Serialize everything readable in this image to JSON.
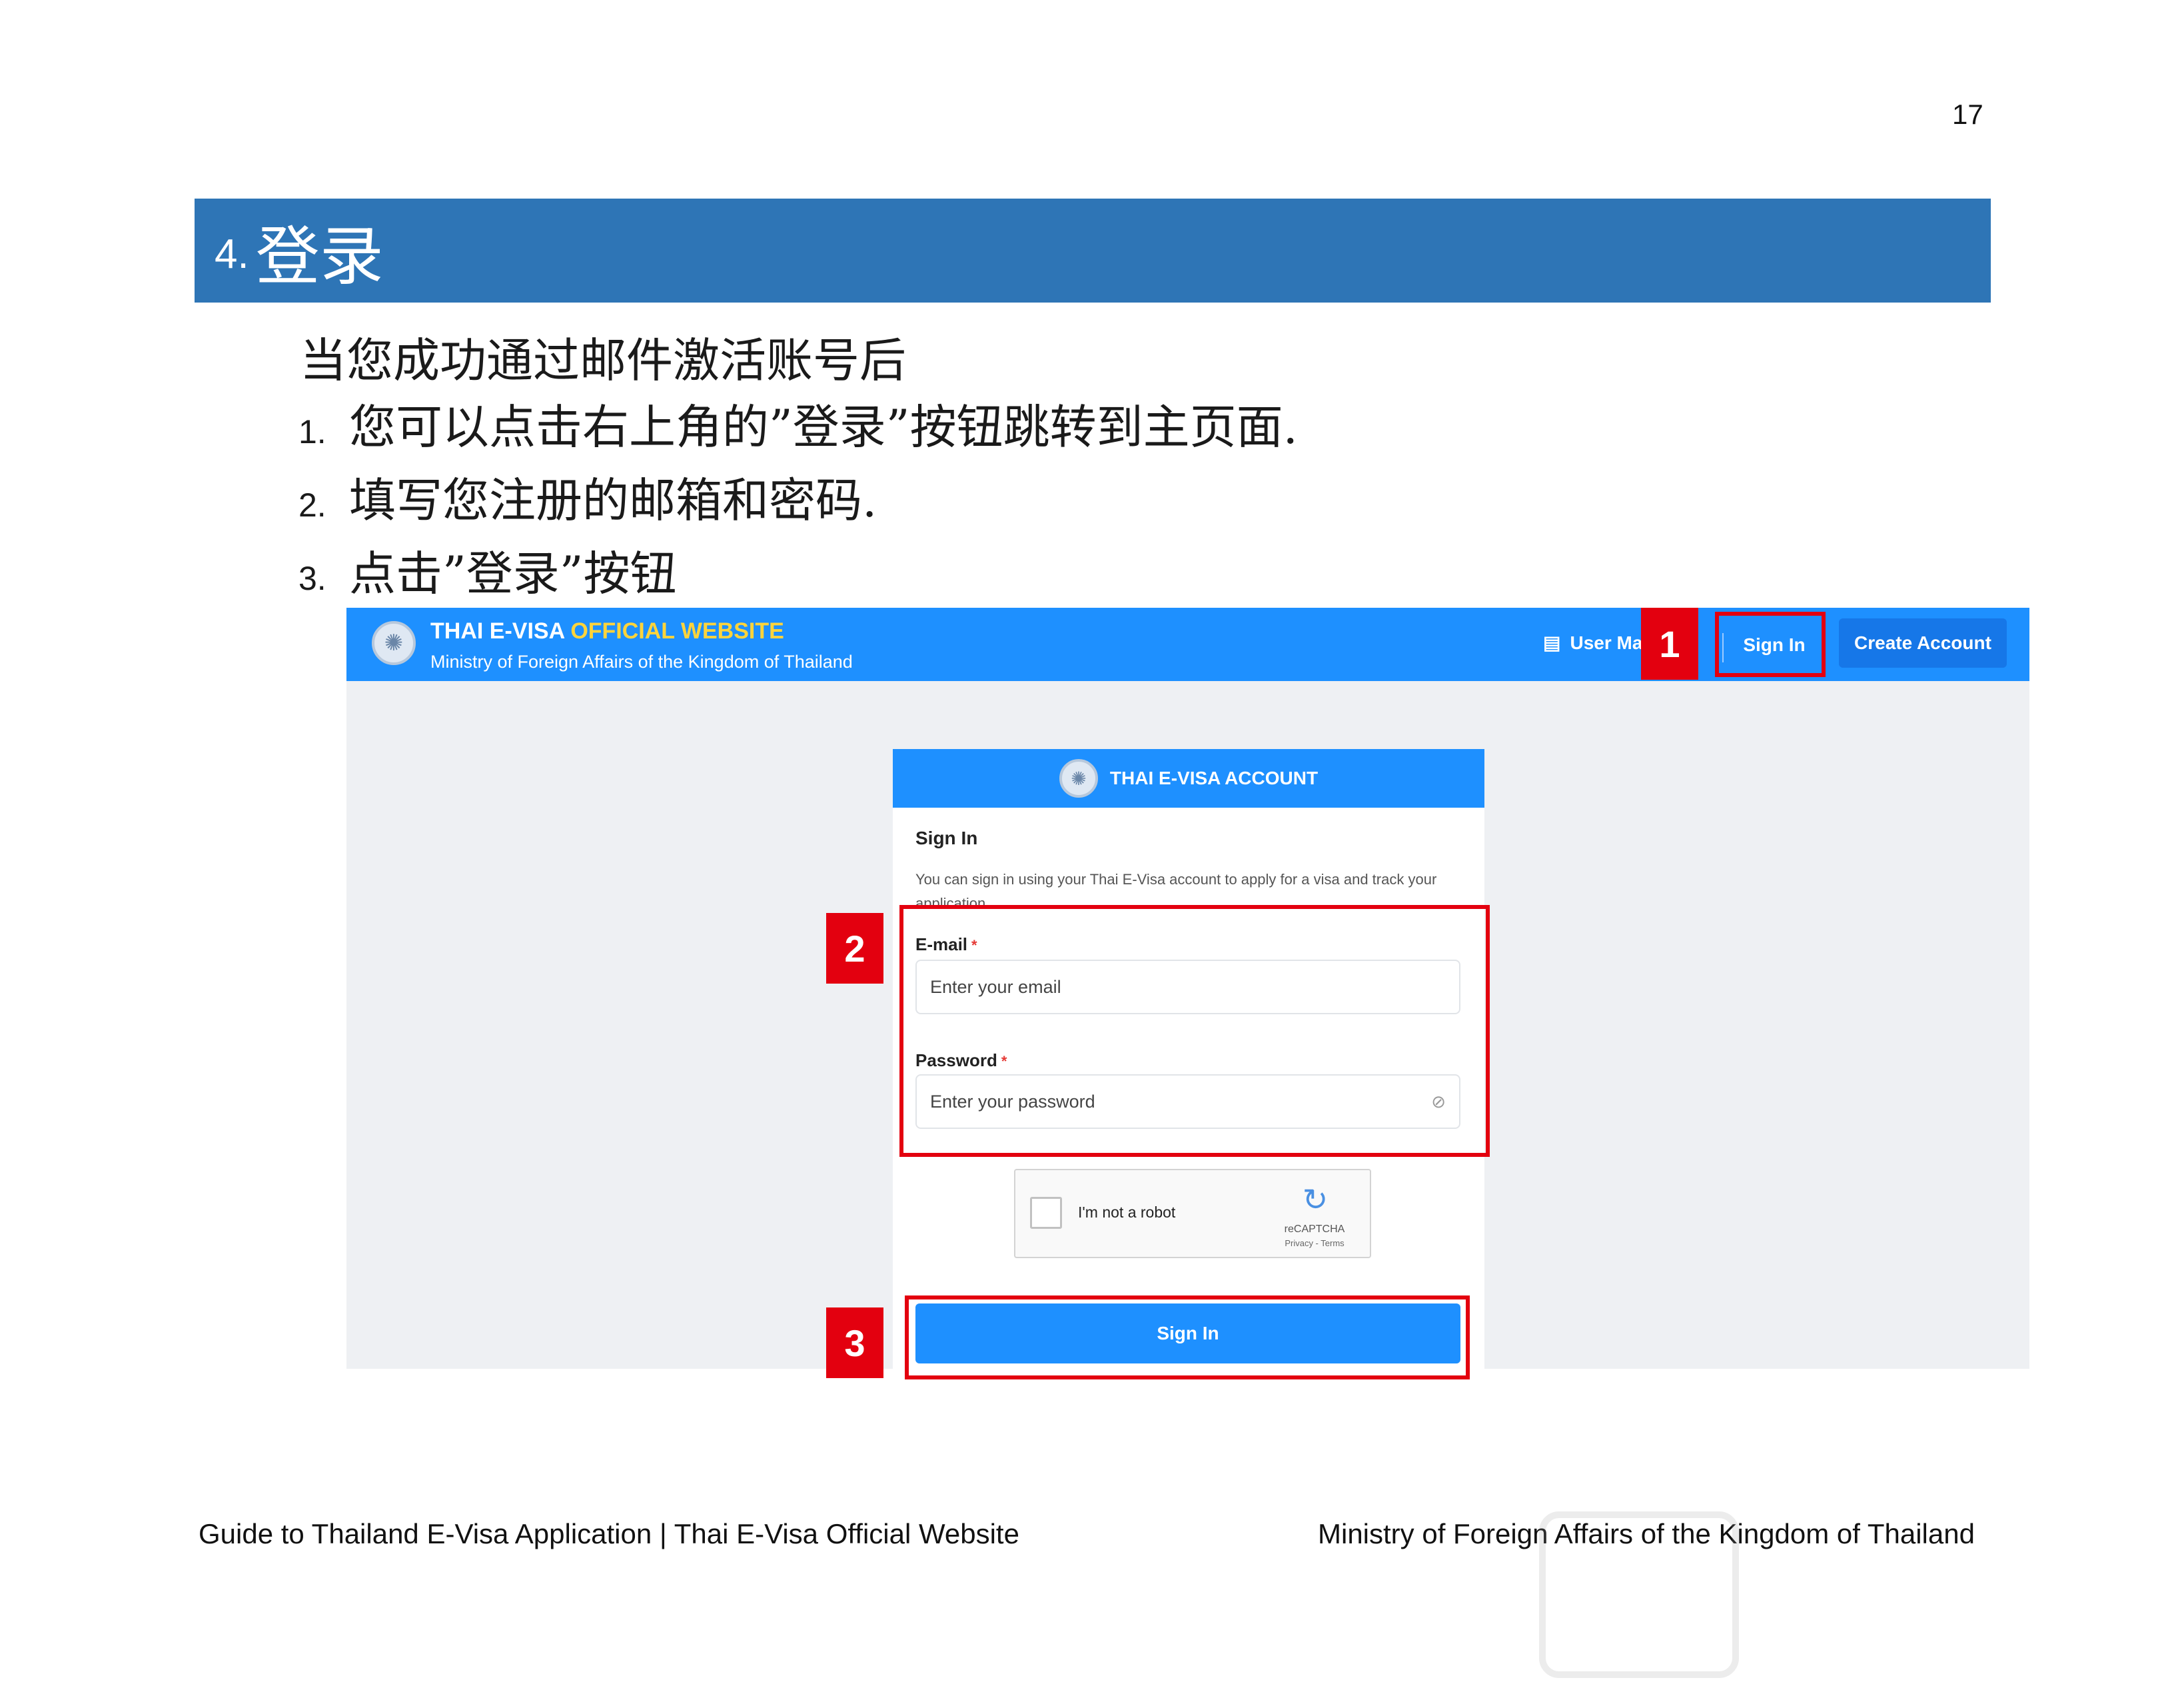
{
  "page_number": "17",
  "section": {
    "number": "4.",
    "title": "登录"
  },
  "intro": "当您成功通过邮件激活账号后",
  "steps": [
    {
      "n": "1.",
      "text": "您可以点击右上角的”登录”按钮跳转到主页面."
    },
    {
      "n": "2.",
      "text": "填写您注册的邮箱和密码."
    },
    {
      "n": "3.",
      "text": "点击”登录”按钮"
    }
  ],
  "screenshot": {
    "header": {
      "title_main": "THAI E-VISA ",
      "title_accent": "OFFICIAL WEBSITE",
      "subtitle": "Ministry of Foreign Affairs of the Kingdom of Thailand",
      "user_manual": "User Ma",
      "sign_in": "Sign In",
      "create_account": "Create Account"
    },
    "card": {
      "title": "THAI E-VISA ACCOUNT",
      "heading": "Sign In",
      "description": "You can sign in using your Thai E-Visa account to apply for a visa and track your application.",
      "email_label": "E-mail",
      "email_placeholder": "Enter your email",
      "password_label": "Password",
      "password_placeholder": "Enter your password",
      "required_mark": "*",
      "captcha_text": "I'm not a robot",
      "captcha_brand": "reCAPTCHA",
      "captcha_links": "Privacy - Terms",
      "submit": "Sign In"
    }
  },
  "callouts": [
    "1",
    "2",
    "3"
  ],
  "highlight_color": "#e3000f",
  "footer": {
    "left": "Guide to Thailand E-Visa Application | Thai E-Visa Official Website",
    "right": "Ministry of Foreign Affairs of the Kingdom of Thailand"
  }
}
